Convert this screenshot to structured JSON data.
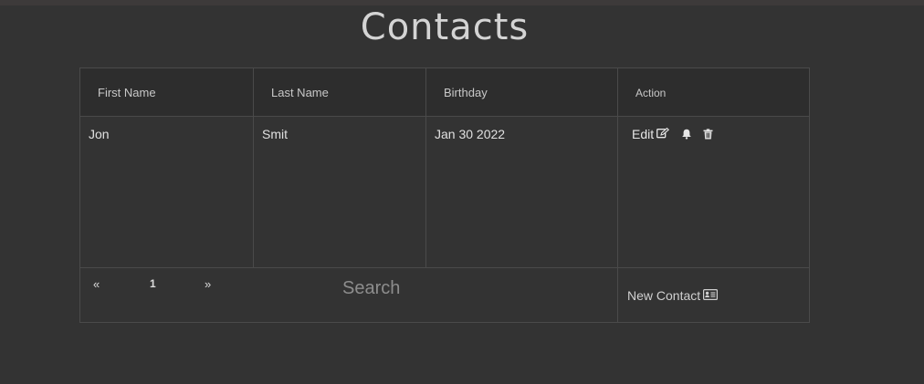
{
  "page": {
    "title": "Contacts"
  },
  "table": {
    "headers": {
      "first_name": "First Name",
      "last_name": "Last Name",
      "birthday": "Birthday",
      "action": "Action"
    },
    "rows": [
      {
        "first_name": "Jon",
        "last_name": "Smit",
        "birthday": "Jan 30 2022",
        "edit_label": "Edit"
      }
    ]
  },
  "footer": {
    "pager": {
      "prev": "«",
      "page": "1",
      "next": "»"
    },
    "search_placeholder": "Search",
    "new_contact_label": "New Contact"
  },
  "icons": {
    "edit": "edit-icon",
    "notify": "bell-icon",
    "delete": "trash-icon",
    "new_contact": "contact-card-icon"
  },
  "colors": {
    "background": "#333333",
    "header_row": "#2d2d2d",
    "border": "#4a4a4a",
    "text": "#e0e0e0",
    "placeholder": "#8d8d8d"
  }
}
